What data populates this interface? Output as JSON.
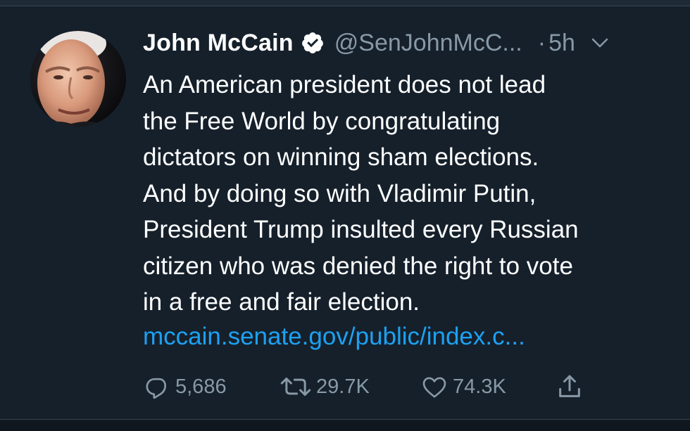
{
  "tweet": {
    "author_name": "John McCain",
    "handle": "@SenJohnMcC...",
    "separator": "·",
    "time": "5h",
    "text": "An American president does not lead\nthe Free World by congratulating\ndictators on winning sham elections.\nAnd by doing so with Vladimir Putin,\nPresident Trump insulted every Russian\ncitizen who was denied the right to vote\nin a free and fair election.",
    "link": "mccain.senate.gov/public/index.c...",
    "replies": "5,686",
    "retweets": "29.7K",
    "likes": "74.3K"
  },
  "icons": {
    "verified": "verified-badge-icon",
    "chevron": "chevron-down-icon",
    "reply": "reply-icon",
    "retweet": "retweet-icon",
    "like": "heart-icon",
    "share": "share-icon"
  },
  "colors": {
    "background": "#15202b",
    "text": "#ffffff",
    "secondary": "#8899a6",
    "link": "#1da1f2"
  }
}
